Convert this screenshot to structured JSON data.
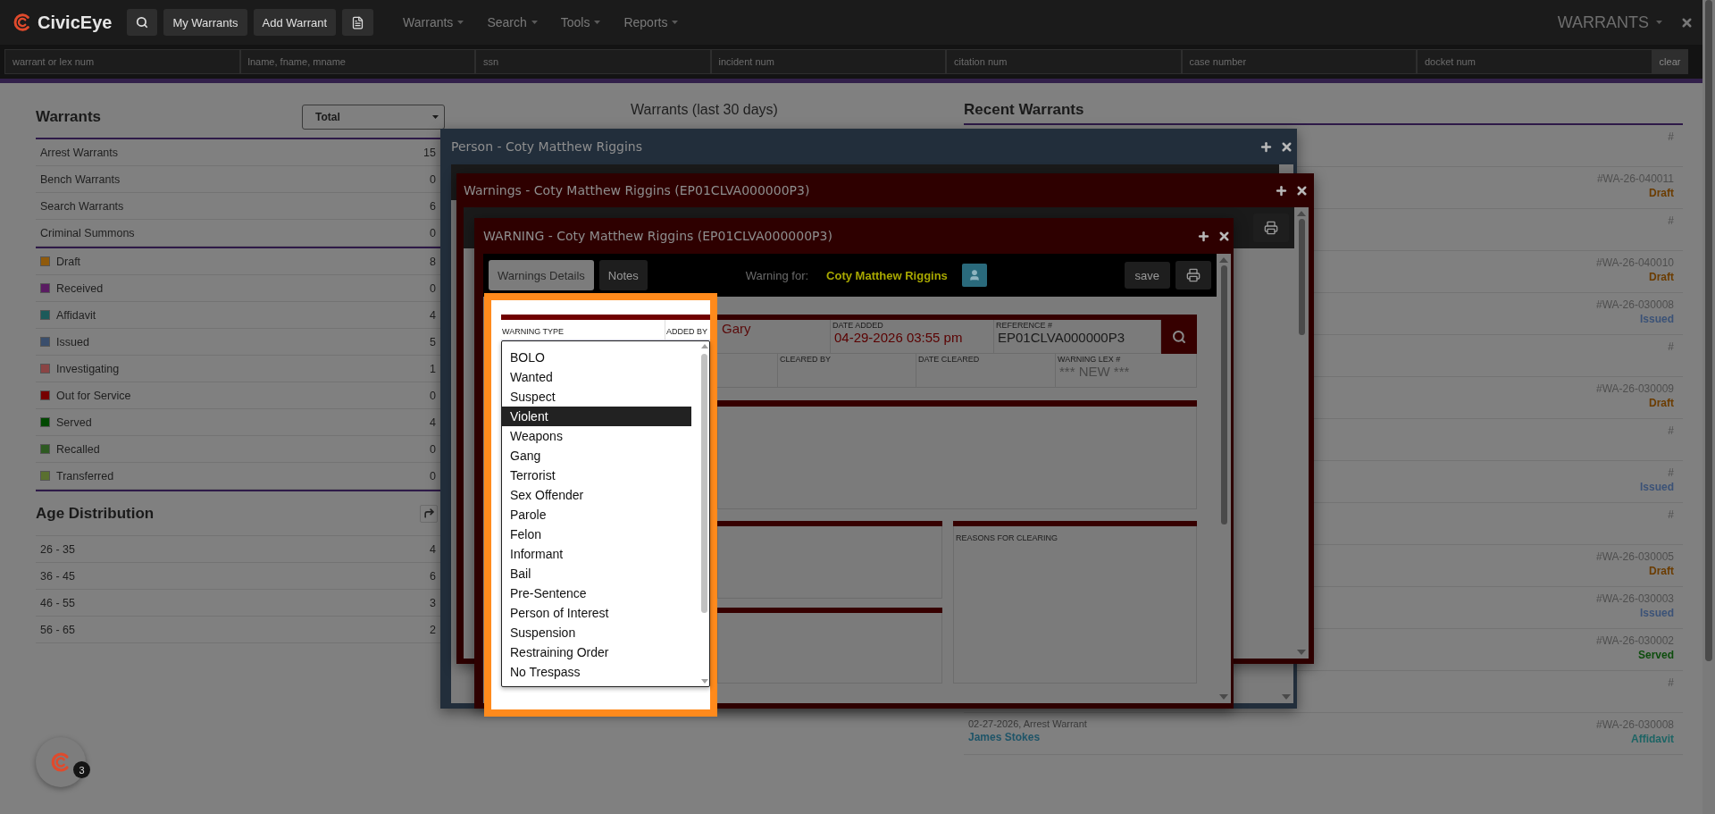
{
  "navbar": {
    "brand": "CivicEye",
    "buttons": [
      "My Warrants",
      "Add Warrant"
    ],
    "menus": [
      "Warrants",
      "Search",
      "Tools",
      "Reports"
    ],
    "module": "WARRANTS"
  },
  "search_fields": [
    {
      "placeholder": "warrant or lex num"
    },
    {
      "placeholder": "lname, fname, mname"
    },
    {
      "placeholder": "ssn"
    },
    {
      "placeholder": "incident num"
    },
    {
      "placeholder": "citation num"
    },
    {
      "placeholder": "case number"
    },
    {
      "placeholder": "docket num"
    }
  ],
  "clear_button": "clear",
  "warrants_panel": {
    "title": "Warrants",
    "filter": "Total",
    "types": [
      {
        "label": "Arrest Warrants",
        "count": "15"
      },
      {
        "label": "Bench Warrants",
        "count": "0"
      },
      {
        "label": "Search Warrants",
        "count": "6"
      },
      {
        "label": "Criminal Summons",
        "count": "0"
      }
    ],
    "statuses": [
      {
        "label": "Draft",
        "count": "8",
        "color": "#8f5a0c"
      },
      {
        "label": "Received",
        "count": "0",
        "color": "#5a1c62"
      },
      {
        "label": "Affidavit",
        "count": "4",
        "color": "#1c5a5a"
      },
      {
        "label": "Issued",
        "count": "5",
        "color": "#3a4e6c"
      },
      {
        "label": "Investigating",
        "count": "1",
        "color": "#8a4444"
      },
      {
        "label": "Out for Service",
        "count": "0",
        "color": "#760000"
      },
      {
        "label": "Served",
        "count": "4",
        "color": "#004800"
      },
      {
        "label": "Recalled",
        "count": "0",
        "color": "#2e5a22"
      },
      {
        "label": "Transferred",
        "count": "0",
        "color": "#5a7030"
      }
    ]
  },
  "age_distribution": {
    "title": "Age Distribution",
    "rows": [
      {
        "label": "26 - 35",
        "count": "4"
      },
      {
        "label": "36 - 45",
        "count": "6"
      },
      {
        "label": "46 - 55",
        "count": "3"
      },
      {
        "label": "56 - 65",
        "count": "2"
      }
    ]
  },
  "chart_title": "Warrants (last 30 days)",
  "recent": {
    "title": "Recent Warrants",
    "rows": [
      {
        "number": "#"
      },
      {
        "number": "#WA-26-040011",
        "status": "Draft",
        "color": "#6b3c00"
      },
      {
        "number": "#"
      },
      {
        "number": "#WA-26-040010",
        "status": "Draft",
        "color": "#6b3c00"
      },
      {
        "number": "#WA-26-030008",
        "status": "Issued",
        "color": "#3b5277"
      },
      {
        "number": "#"
      },
      {
        "number": "#WA-26-030009",
        "status": "Draft",
        "color": "#6b3c00"
      },
      {
        "number": "#"
      },
      {
        "number": "#",
        "status": "Issued",
        "color": "#3b5277"
      },
      {
        "number": "#"
      },
      {
        "number": "#WA-26-030005",
        "status": "Draft",
        "color": "#6b3c00"
      },
      {
        "number": "#WA-26-030003",
        "status": "Issued",
        "color": "#3b5277"
      },
      {
        "number": "#WA-26-030002",
        "status": "Served",
        "color": "#0d4d0d"
      },
      {
        "number": "#"
      },
      {
        "number": "#WA-26-030008",
        "status": "Affidavit",
        "color": "#1d6464",
        "date_type": "02-27-2026, Arrest Warrant",
        "name": "James Stokes"
      }
    ]
  },
  "windows": {
    "person": {
      "title": "Person - Coty Matthew Riggins"
    },
    "warnings": {
      "title": "Warnings - Coty Matthew Riggins (EP01CLVA000000P3)"
    },
    "warning": {
      "title": "WARNING - Coty Matthew Riggins (EP01CLVA000000P3)",
      "tabs": [
        {
          "label": "Warnings Details",
          "selected": true
        },
        {
          "label": "Notes",
          "selected": false
        }
      ],
      "warning_for_label": "Warning for:",
      "subject": "Coty Matthew Riggins",
      "save": "save",
      "form": {
        "warning_type_label": "WARNING TYPE",
        "added_by_label": "ADDED BY",
        "added_by": "Gary",
        "date_added_label": "DATE ADDED",
        "date_added": "04-29-2026 03:55 pm",
        "reference_label": "REFERENCE #",
        "reference": "EP01CLVA000000P3",
        "cleared_by_label": "CLEARED BY",
        "date_cleared_label": "DATE CLEARED",
        "lex_label": "WARNING LEX #",
        "lex_placeholder": "*** NEW ***",
        "reasons_label": "REASONS FOR CLEARING"
      },
      "dropdown": {
        "options": [
          {
            "label": "BOLO",
            "selected": false
          },
          {
            "label": "Wanted",
            "selected": false
          },
          {
            "label": "Suspect",
            "selected": false
          },
          {
            "label": "Violent",
            "selected": true
          },
          {
            "label": "Weapons",
            "selected": false
          },
          {
            "label": "Gang",
            "selected": false
          },
          {
            "label": "Terrorist",
            "selected": false
          },
          {
            "label": "Sex Offender",
            "selected": false
          },
          {
            "label": "Parole",
            "selected": false
          },
          {
            "label": "Felon",
            "selected": false
          },
          {
            "label": "Informant",
            "selected": false
          },
          {
            "label": "Bail",
            "selected": false
          },
          {
            "label": "Pre-Sentence",
            "selected": false
          },
          {
            "label": "Person of Interest",
            "selected": false
          },
          {
            "label": "Suspension",
            "selected": false
          },
          {
            "label": "Restraining Order",
            "selected": false
          },
          {
            "label": "No Trespass",
            "selected": false
          }
        ]
      }
    }
  },
  "notification_count": "3"
}
